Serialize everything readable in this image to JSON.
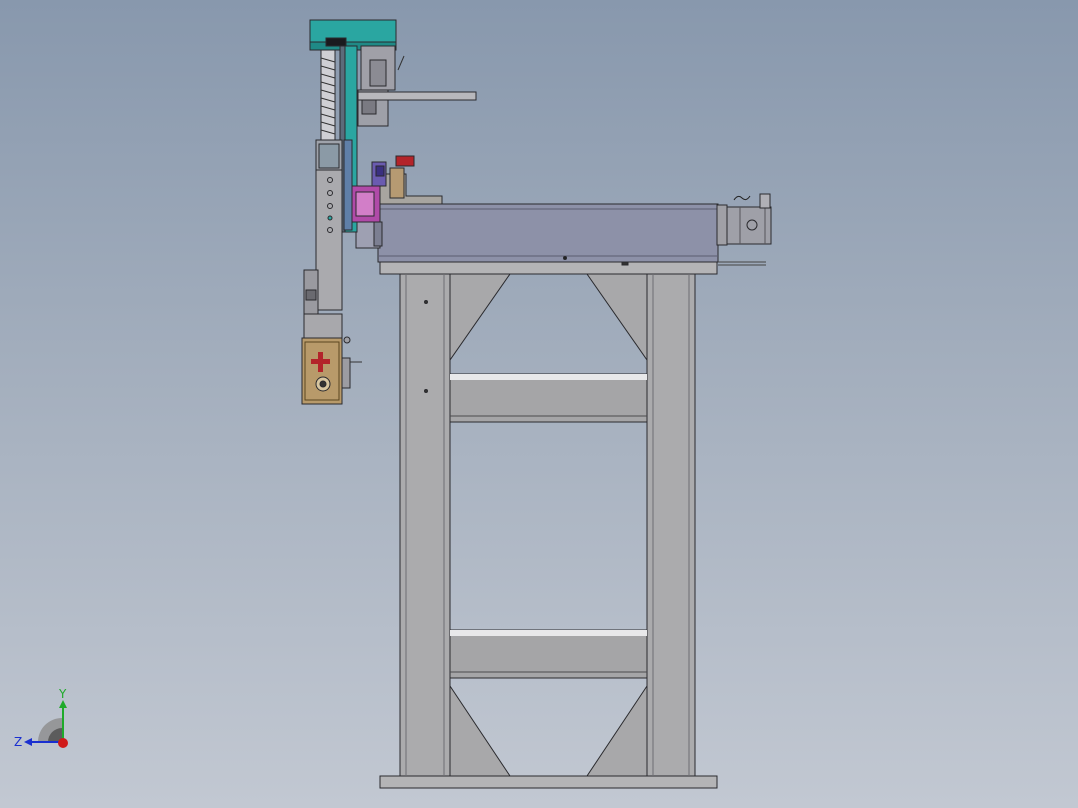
{
  "view": {
    "colors": {
      "frame_steel": "#a9a9ab",
      "frame_steel_dark": "#8e8e92",
      "outline": "#2a2a2e",
      "housing": "#8c90a8",
      "teal": "#2aa6a1",
      "brass": "#b89a6a",
      "red": "#b3242a",
      "magenta": "#b04aa8",
      "violet": "#6a5bb0",
      "motor": "#9a9aa2"
    }
  },
  "triad": {
    "y_label": "Y",
    "z_label": "Z",
    "colors": {
      "y": "#1faa2a",
      "z": "#1a2fd0",
      "x": "#d01a1a"
    }
  }
}
